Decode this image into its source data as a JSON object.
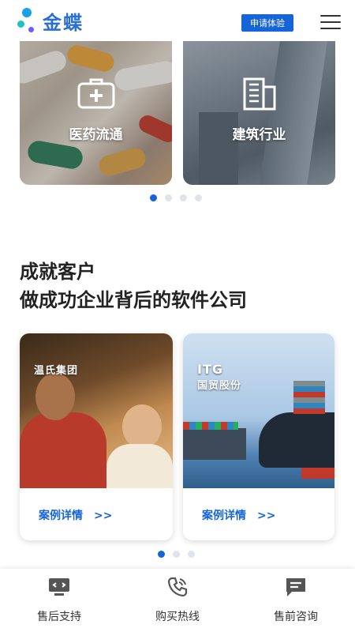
{
  "header": {
    "logo_text": "金蝶",
    "trial_button": "申请体验",
    "menu_icon": "hamburger-menu-icon"
  },
  "industries": [
    {
      "label": "医药流通",
      "icon": "medical-case-icon"
    },
    {
      "label": "建筑行业",
      "icon": "building-icon"
    }
  ],
  "industry_carousel": {
    "dot_count": 4,
    "active_index": 0
  },
  "section": {
    "title_line1": "成就客户",
    "title_line2": "做成功企业背后的软件公司"
  },
  "cases": [
    {
      "logo_text": "温氏集团",
      "link_label": "案例详情",
      "link_arrow": ">>"
    },
    {
      "logo_text": "国贸股份",
      "logo_sub": "ITG",
      "link_label": "案例详情",
      "link_arrow": ">>"
    }
  ],
  "case_carousel": {
    "dot_count": 3,
    "active_index": 0
  },
  "bottom_nav": [
    {
      "label": "售后支持",
      "icon": "remote-support-icon"
    },
    {
      "label": "购买热线",
      "icon": "phone-icon"
    },
    {
      "label": "售前咨询",
      "icon": "chat-icon"
    }
  ],
  "colors": {
    "accent": "#1565d8",
    "logo": "#2a6fd6"
  }
}
